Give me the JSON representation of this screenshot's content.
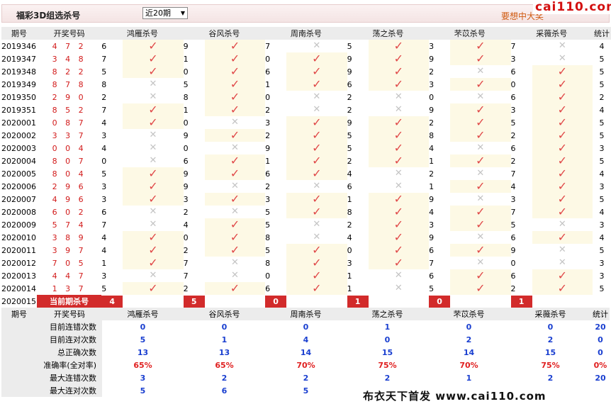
{
  "header": {
    "title": "福彩3D组选杀号",
    "select_value": "近20期",
    "promo": "要想中大奖",
    "logo": "cai110.com"
  },
  "columns": [
    "期号",
    "开奖号码",
    "鸿雁杀号",
    "谷风杀号",
    "周南杀号",
    "荡之杀号",
    "芣苡杀号",
    "采薇杀号",
    "统计"
  ],
  "rows": [
    {
      "period": "2019346",
      "draw": "4 7 2",
      "kills": [
        6,
        9,
        7,
        5,
        3,
        7
      ],
      "results": [
        1,
        1,
        0,
        1,
        1,
        0
      ],
      "total": "4"
    },
    {
      "period": "2019347",
      "draw": "3 4 8",
      "kills": [
        7,
        1,
        0,
        9,
        9,
        3
      ],
      "results": [
        1,
        1,
        1,
        1,
        1,
        0
      ],
      "total": "5"
    },
    {
      "period": "2019348",
      "draw": "8 2 2",
      "kills": [
        5,
        0,
        6,
        9,
        2,
        6
      ],
      "results": [
        1,
        1,
        1,
        1,
        0,
        1
      ],
      "total": "5"
    },
    {
      "period": "2019349",
      "draw": "8 7 8",
      "kills": [
        8,
        5,
        1,
        6,
        3,
        0
      ],
      "results": [
        0,
        1,
        1,
        1,
        1,
        1
      ],
      "total": "5"
    },
    {
      "period": "2019350",
      "draw": "2 9 0",
      "kills": [
        2,
        8,
        0,
        2,
        0,
        6
      ],
      "results": [
        0,
        1,
        0,
        0,
        0,
        1
      ],
      "total": "2"
    },
    {
      "period": "2019351",
      "draw": "8 5 2",
      "kills": [
        7,
        1,
        2,
        2,
        9,
        3
      ],
      "results": [
        1,
        1,
        0,
        0,
        1,
        1
      ],
      "total": "4"
    },
    {
      "period": "2020001",
      "draw": "0 8 7",
      "kills": [
        4,
        0,
        3,
        9,
        2,
        5
      ],
      "results": [
        1,
        0,
        1,
        1,
        1,
        1
      ],
      "total": "5"
    },
    {
      "period": "2020002",
      "draw": "3 3 7",
      "kills": [
        3,
        9,
        2,
        5,
        8,
        2
      ],
      "results": [
        0,
        1,
        1,
        1,
        1,
        1
      ],
      "total": "5"
    },
    {
      "period": "2020003",
      "draw": "0 0 4",
      "kills": [
        4,
        0,
        9,
        5,
        4,
        6
      ],
      "results": [
        0,
        0,
        1,
        1,
        0,
        1
      ],
      "total": "3"
    },
    {
      "period": "2020004",
      "draw": "8 0 7",
      "kills": [
        0,
        6,
        1,
        2,
        1,
        2
      ],
      "results": [
        0,
        1,
        1,
        1,
        1,
        1
      ],
      "total": "5"
    },
    {
      "period": "2020005",
      "draw": "8 0 4",
      "kills": [
        5,
        9,
        6,
        4,
        2,
        7
      ],
      "results": [
        1,
        1,
        1,
        0,
        0,
        1
      ],
      "total": "4"
    },
    {
      "period": "2020006",
      "draw": "2 9 6",
      "kills": [
        3,
        9,
        2,
        6,
        1,
        4
      ],
      "results": [
        1,
        0,
        0,
        0,
        1,
        1
      ],
      "total": "3"
    },
    {
      "period": "2020007",
      "draw": "4 9 6",
      "kills": [
        3,
        3,
        3,
        1,
        9,
        3
      ],
      "results": [
        1,
        1,
        1,
        1,
        0,
        1
      ],
      "total": "5"
    },
    {
      "period": "2020008",
      "draw": "6 0 2",
      "kills": [
        6,
        2,
        5,
        8,
        4,
        7
      ],
      "results": [
        0,
        0,
        1,
        1,
        1,
        1
      ],
      "total": "4"
    },
    {
      "period": "2020009",
      "draw": "5 7 4",
      "kills": [
        7,
        4,
        5,
        2,
        3,
        5
      ],
      "results": [
        0,
        1,
        0,
        1,
        1,
        0
      ],
      "total": "3"
    },
    {
      "period": "2020010",
      "draw": "3 8 9",
      "kills": [
        4,
        0,
        8,
        4,
        9,
        6
      ],
      "results": [
        1,
        1,
        0,
        1,
        0,
        1
      ],
      "total": "4"
    },
    {
      "period": "2020011",
      "draw": "3 9 7",
      "kills": [
        4,
        2,
        5,
        0,
        6,
        9
      ],
      "results": [
        1,
        1,
        1,
        1,
        1,
        0
      ],
      "total": "5"
    },
    {
      "period": "2020012",
      "draw": "7 0 5",
      "kills": [
        1,
        7,
        8,
        3,
        7,
        0
      ],
      "results": [
        1,
        0,
        1,
        1,
        0,
        0
      ],
      "total": "3"
    },
    {
      "period": "2020013",
      "draw": "4 4 7",
      "kills": [
        3,
        7,
        0,
        1,
        6,
        6
      ],
      "results": [
        0,
        0,
        1,
        0,
        1,
        1
      ],
      "total": "3"
    },
    {
      "period": "2020014",
      "draw": "1 3 7",
      "kills": [
        5,
        2,
        6,
        1,
        5,
        2
      ],
      "results": [
        1,
        1,
        1,
        0,
        1,
        1
      ],
      "total": "5"
    }
  ],
  "current": {
    "period": "2020015",
    "label": "当前期杀号",
    "kills": [
      "4",
      "5",
      "0",
      "1",
      "0",
      "1"
    ]
  },
  "stats": {
    "rows": [
      {
        "label": "目前连错次数",
        "values": [
          "0",
          "0",
          "0",
          "1",
          "0",
          "0",
          "20"
        ]
      },
      {
        "label": "目前连对次数",
        "values": [
          "5",
          "1",
          "4",
          "0",
          "2",
          "2",
          "0"
        ]
      },
      {
        "label": "总正确次数",
        "values": [
          "13",
          "13",
          "14",
          "15",
          "14",
          "15",
          "0"
        ]
      },
      {
        "label": "准确率(全对率)",
        "values": [
          "65%",
          "65%",
          "70%",
          "75%",
          "70%",
          "75%",
          "0%"
        ],
        "red": true
      },
      {
        "label": "最大连错次数",
        "values": [
          "3",
          "2",
          "2",
          "2",
          "1",
          "2",
          "20"
        ]
      },
      {
        "label": "最大连对次数",
        "values": [
          "5",
          "6",
          "5",
          "",
          "",
          "",
          ""
        ]
      }
    ]
  },
  "footer": "布衣天下首发 www.cai110.com",
  "colors": {
    "check": "#e04848",
    "cross": "#c4c4c4",
    "accent": "#d22b2b",
    "stat_value": "#1a3fd0"
  }
}
